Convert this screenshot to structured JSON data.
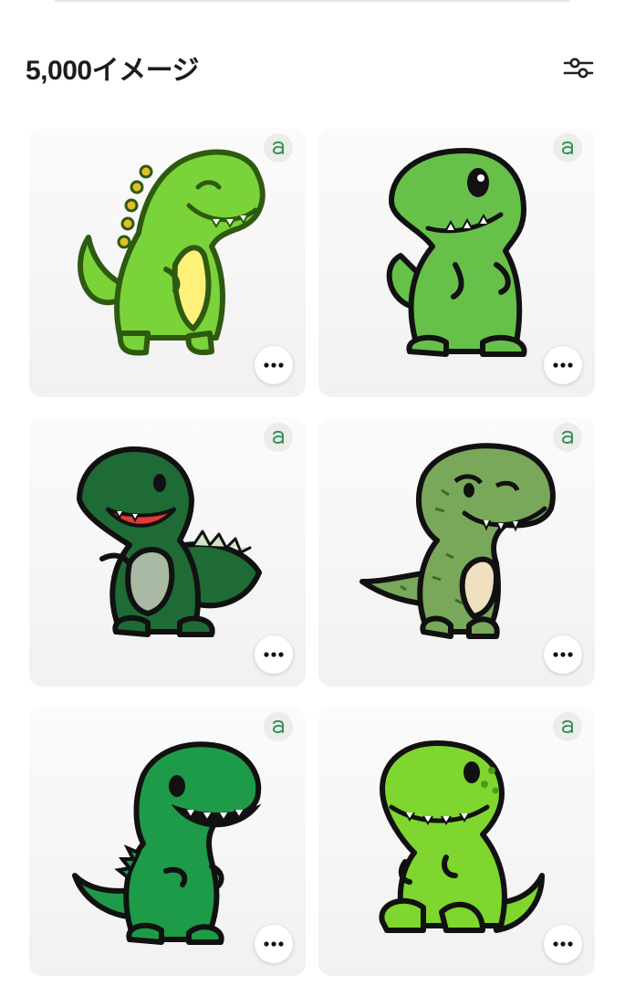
{
  "header": {
    "result_count": "5,000イメージ"
  },
  "icons": {
    "filter": "sliders-filter-icon",
    "badge": "ai-generated-badge-icon",
    "more": "more-options-icon"
  },
  "colors": {
    "badge_icon": "#3b8f5a",
    "more_dots": "#111111",
    "card_bg": "#f3f3f3"
  },
  "images": [
    {
      "subject": "dinosaur",
      "body_color": "#7bd33a",
      "belly_color": "#fff07a",
      "outline": "#2e5a10",
      "style": "smiling with spikes"
    },
    {
      "subject": "dinosaur",
      "body_color": "#67c04a",
      "belly_color": "#67c04a",
      "outline": "#111111",
      "style": "standing"
    },
    {
      "subject": "dinosaur",
      "body_color": "#1f6b35",
      "belly_color": "#a9b9a3",
      "outline": "#111111",
      "style": "laughing with red tongue"
    },
    {
      "subject": "dinosaur",
      "body_color": "#7aa85a",
      "belly_color": "#efe1bd",
      "outline": "#111111",
      "style": "textured"
    },
    {
      "subject": "dinosaur",
      "body_color": "#1e9b48",
      "belly_color": "#1e9b48",
      "outline": "#111111",
      "style": "roaring"
    },
    {
      "subject": "dinosaur",
      "body_color": "#7fd62e",
      "belly_color": "#7fd62e",
      "outline": "#111111",
      "style": "sitting"
    }
  ]
}
